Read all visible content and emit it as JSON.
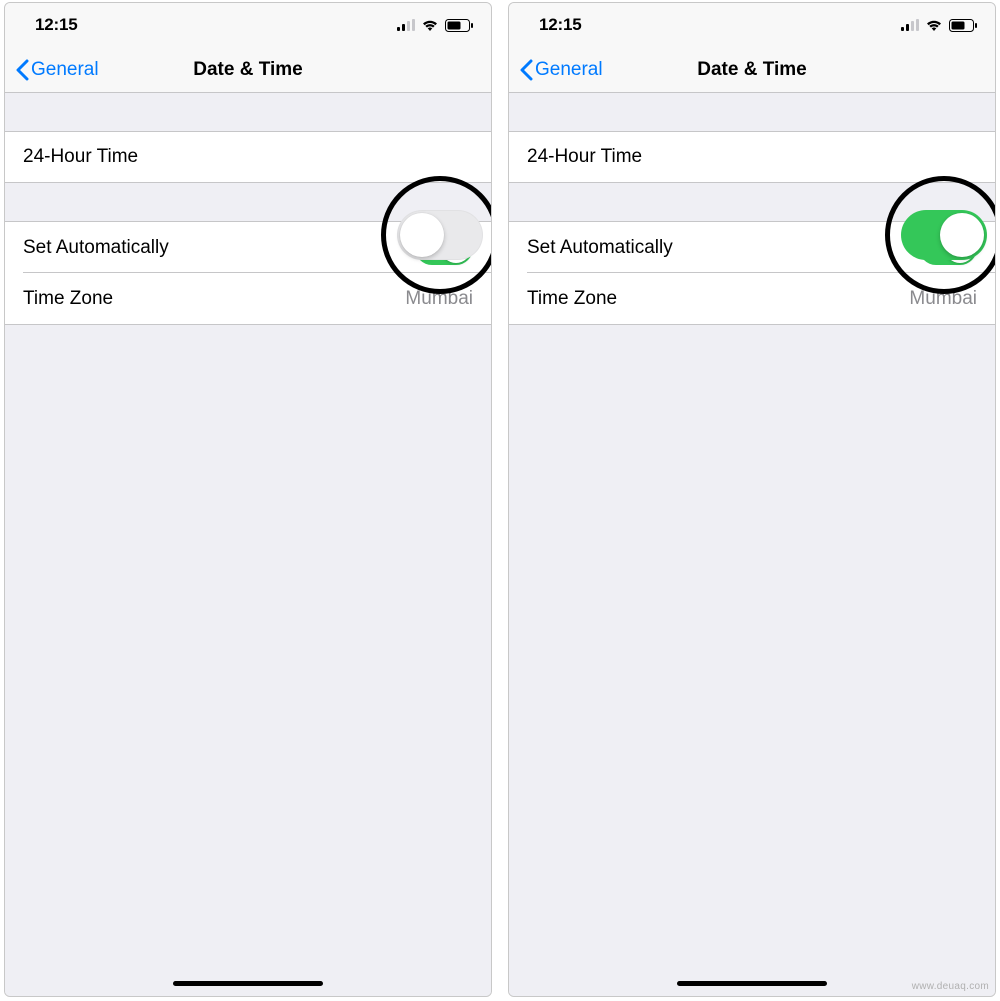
{
  "watermark": "www.deuaq.com",
  "screens": [
    {
      "status": {
        "time": "12:15"
      },
      "nav": {
        "back_label": "General",
        "title": "Date & Time"
      },
      "rows": {
        "hour24": {
          "label": "24-Hour Time",
          "on": false
        },
        "set_auto": {
          "label": "Set Automatically",
          "on": true
        },
        "timezone": {
          "label": "Time Zone",
          "value": "Mumbai"
        }
      }
    },
    {
      "status": {
        "time": "12:15"
      },
      "nav": {
        "back_label": "General",
        "title": "Date & Time"
      },
      "rows": {
        "hour24": {
          "label": "24-Hour Time",
          "on": true
        },
        "set_auto": {
          "label": "Set Automatically",
          "on": true
        },
        "timezone": {
          "label": "Time Zone",
          "value": "Mumbai"
        }
      }
    }
  ]
}
